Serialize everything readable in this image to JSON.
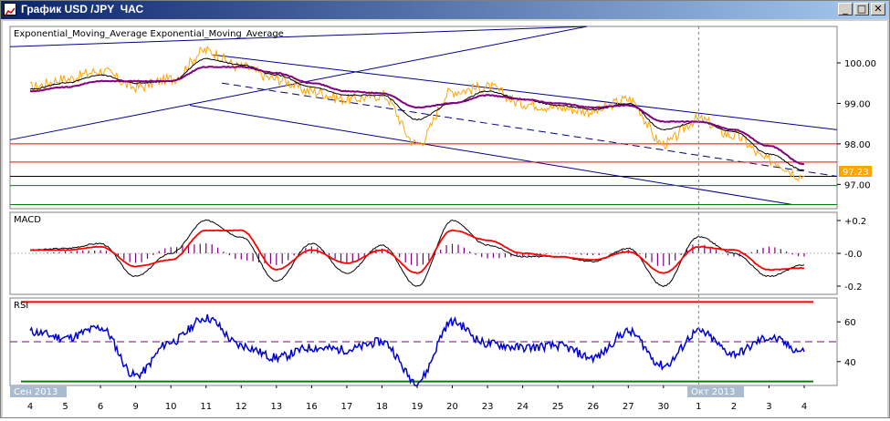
{
  "window": {
    "title": "График USD /JPY  ЧАС",
    "minimize_glyph": "_",
    "maximize_glyph": "□",
    "close_glyph": "✕"
  },
  "icons": [
    "chart-icon",
    "minimize-icon",
    "maximize-icon",
    "close-icon"
  ],
  "colors": {
    "price": "#ffa500",
    "ema_fast": "#000000",
    "ema_slow": "#800080",
    "channel": "#00008b",
    "resistance": "#ff0000",
    "support": "#008000",
    "macd_line": "#000000",
    "macd_signal": "#ff0000",
    "macd_hist": "#800080",
    "rsi_line": "#0000cd",
    "current_price_tag": "#ffa500"
  },
  "main_panel": {
    "title": "Exponential_Moving_Average Exponential_Moving_Average",
    "y_ticks": [
      "100.00",
      "99.00",
      "98.00",
      "97.00"
    ],
    "current_price": "97.23"
  },
  "macd_panel": {
    "title": "MACD",
    "y_ticks": [
      "+0.2",
      "-0.0",
      "-0.2"
    ]
  },
  "rsi_panel": {
    "title": "RSI",
    "y_ticks": [
      "60",
      "40"
    ]
  },
  "x_axis": {
    "month_labels": [
      "Сен 2013",
      "Окт 2013"
    ],
    "day_labels": [
      "4",
      "5",
      "6",
      "9",
      "10",
      "11",
      "12",
      "13",
      "16",
      "17",
      "18",
      "19",
      "20",
      "23",
      "24",
      "25",
      "26",
      "27",
      "30",
      "1",
      "2",
      "3",
      "4"
    ]
  },
  "chart_data": [
    {
      "type": "line",
      "title": "Exponential_Moving_Average Exponential_Moving_Average",
      "x": [
        "4",
        "5",
        "6",
        "9",
        "10",
        "11",
        "12",
        "13",
        "16",
        "17",
        "18",
        "19",
        "20",
        "23",
        "24",
        "25",
        "26",
        "27",
        "30",
        "1",
        "2",
        "3",
        "4"
      ],
      "series": [
        {
          "values": [
            99.4,
            99.6,
            99.8,
            99.4,
            99.6,
            100.3,
            99.9,
            99.6,
            99.3,
            99.1,
            99.2,
            98.0,
            99.3,
            99.4,
            99.0,
            98.9,
            98.8,
            99.1,
            98.0,
            98.6,
            98.2,
            97.6,
            97.2
          ]
        },
        {
          "values": [
            99.35,
            99.5,
            99.7,
            99.5,
            99.55,
            100.1,
            99.95,
            99.7,
            99.4,
            99.2,
            99.2,
            98.6,
            99.0,
            99.3,
            99.1,
            98.95,
            98.85,
            99.0,
            98.35,
            98.55,
            98.3,
            97.75,
            97.35
          ]
        },
        {
          "values": [
            99.3,
            99.4,
            99.55,
            99.55,
            99.55,
            99.9,
            99.9,
            99.75,
            99.5,
            99.3,
            99.25,
            98.9,
            99.0,
            99.2,
            99.1,
            99.0,
            98.9,
            98.95,
            98.55,
            98.55,
            98.35,
            97.95,
            97.5
          ]
        }
      ],
      "horizontal_levels": [
        98.0,
        97.55,
        97.2,
        96.97,
        96.5
      ],
      "ylim": [
        96.4,
        100.9
      ],
      "current_value": 97.23
    },
    {
      "type": "line",
      "title": "MACD",
      "x": [
        "4",
        "5",
        "6",
        "9",
        "10",
        "11",
        "12",
        "13",
        "16",
        "17",
        "18",
        "19",
        "20",
        "23",
        "24",
        "25",
        "26",
        "27",
        "30",
        "1",
        "2",
        "3",
        "4"
      ],
      "series": [
        {
          "values": [
            0.02,
            0.03,
            0.06,
            -0.14,
            0.0,
            0.2,
            0.1,
            -0.17,
            0.06,
            -0.12,
            0.05,
            -0.2,
            0.2,
            0.05,
            -0.02,
            -0.02,
            -0.05,
            0.03,
            -0.2,
            0.1,
            0.0,
            -0.14,
            -0.07
          ]
        },
        {
          "values": [
            0.02,
            0.02,
            0.04,
            -0.08,
            -0.04,
            0.14,
            0.14,
            -0.1,
            0.02,
            -0.06,
            0.02,
            -0.12,
            0.14,
            0.08,
            0.0,
            -0.02,
            -0.04,
            0.01,
            -0.12,
            0.04,
            0.02,
            -0.1,
            -0.09
          ]
        }
      ],
      "histogram": [
        0.0,
        0.01,
        0.02,
        -0.06,
        0.04,
        0.06,
        -0.04,
        -0.07,
        0.04,
        -0.06,
        0.03,
        -0.08,
        0.06,
        -0.03,
        -0.02,
        0.0,
        -0.01,
        0.02,
        -0.08,
        0.06,
        -0.02,
        0.04,
        -0.02
      ],
      "ylim": [
        -0.25,
        0.25
      ]
    },
    {
      "type": "line",
      "title": "RSI",
      "x": [
        "4",
        "5",
        "6",
        "9",
        "10",
        "11",
        "12",
        "13",
        "16",
        "17",
        "18",
        "19",
        "20",
        "23",
        "24",
        "25",
        "26",
        "27",
        "30",
        "1",
        "2",
        "3",
        "4"
      ],
      "series": [
        {
          "values": [
            55,
            52,
            57,
            33,
            50,
            62,
            48,
            42,
            47,
            46,
            50,
            30,
            60,
            49,
            47,
            48,
            42,
            55,
            38,
            55,
            44,
            52,
            45
          ]
        }
      ],
      "horizontal_levels": [
        70,
        50,
        30
      ],
      "ylim": [
        28,
        72
      ]
    }
  ]
}
